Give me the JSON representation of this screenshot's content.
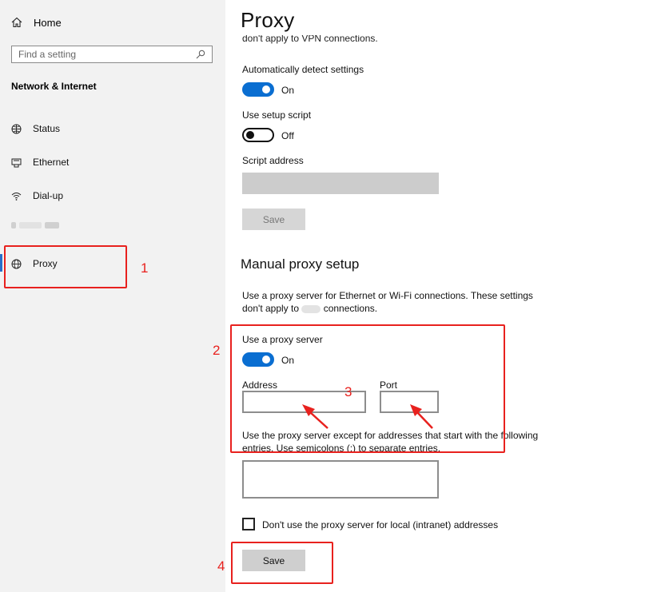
{
  "sidebar": {
    "home_label": "Home",
    "search_placeholder": "Find a setting",
    "section_title": "Network & Internet",
    "items": [
      {
        "label": "Status",
        "icon": "globe-status-icon"
      },
      {
        "label": "Ethernet",
        "icon": "ethernet-icon"
      },
      {
        "label": "Dial-up",
        "icon": "dial-up-icon"
      },
      {
        "label": "Proxy",
        "icon": "globe-icon"
      }
    ]
  },
  "main": {
    "title": "Proxy",
    "cut_text": "don't apply to VPN connections.",
    "auto_detect": {
      "label": "Automatically detect settings",
      "state": "On"
    },
    "setup_script": {
      "label": "Use setup script",
      "state": "Off"
    },
    "script_address_label": "Script address",
    "save_label_1": "Save",
    "manual_heading": "Manual proxy setup",
    "manual_desc_line1": "Use a proxy server for Ethernet or Wi-Fi connections. These settings",
    "manual_desc_line2a": "don't apply to",
    "manual_desc_line2b": "connections.",
    "use_proxy": {
      "label": "Use a proxy server",
      "state": "On"
    },
    "address_label": "Address",
    "port_label": "Port",
    "exceptions_text": "Use the proxy server except for addresses that start with the following entries. Use semicolons (;) to separate entries.",
    "local_checkbox_label": "Don't use the proxy server for local (intranet) addresses",
    "save_label_2": "Save"
  },
  "annotations": [
    "1",
    "2",
    "3",
    "4"
  ],
  "colors": {
    "accent": "#0a6ed1",
    "annotation": "#e8211e",
    "sidebar_bg": "#f2f2f2"
  }
}
